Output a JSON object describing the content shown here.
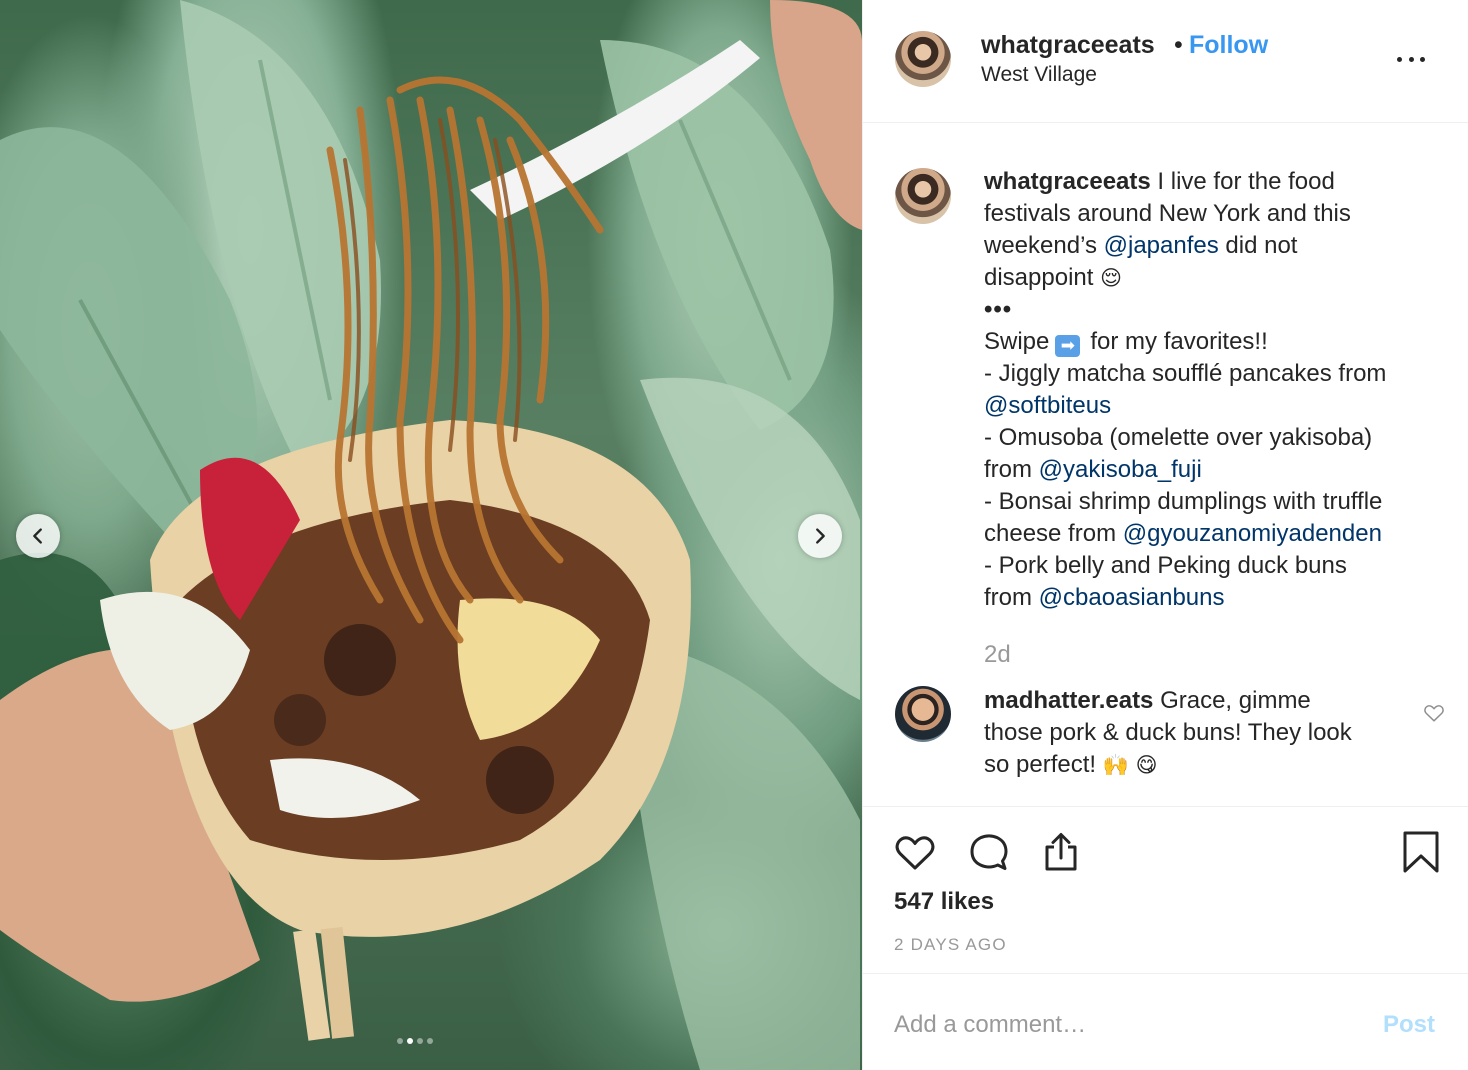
{
  "post": {
    "username": "whatgraceeats",
    "follow_label": "Follow",
    "separator": "•",
    "location": "West Village"
  },
  "media": {
    "photo_icon": "photo-noodles",
    "carousel_slide_count": 4,
    "carousel_active_index": 1
  },
  "caption": {
    "username": "whatgraceeats",
    "line1_text": " I live for the food",
    "line2_text": "festivals around New York and this",
    "line3_pre": "weekend’s ",
    "line3_mention": "@japanfes",
    "line3_post": " did not",
    "line4_text": "disappoint ",
    "line4_emoji": "😌",
    "line5_text": "•••",
    "line6_pre": "Swipe",
    "line6_emoji": "➡",
    "line6_post": "for my favorites!!",
    "line7_text": "- Jiggly matcha soufflé pancakes from",
    "line8_mention": "@softbiteus",
    "line9_text": "- Omusoba (omelette over yakisoba)",
    "line10_pre": "from ",
    "line10_mention": "@yakisoba_fuji",
    "line11_text": "- Bonsai shrimp dumplings with truffle",
    "line12_pre": "cheese from ",
    "line12_mention": "@gyouzanomiyadenden",
    "line13_text": "- Pork belly and Peking duck buns",
    "line14_pre": "from ",
    "line14_mention": "@cbaoasianbuns",
    "time_ago": "2d"
  },
  "comment": {
    "username": "madhatter.eats",
    "line1_text": " Grace, gimme",
    "line2_text": "those pork & duck buns! They look",
    "line3_text": "so perfect! ",
    "line3_emoji1": "🙌",
    "line3_emoji2": "😋"
  },
  "actions": {
    "likes": "547 likes",
    "date": "2 DAYS AGO"
  },
  "add_comment": {
    "placeholder": "Add a comment…",
    "post_label": "Post"
  },
  "colors": {
    "accent": "#3897f0",
    "mention": "#003569",
    "muted": "#999999",
    "post_disabled": "#b2dffc"
  }
}
